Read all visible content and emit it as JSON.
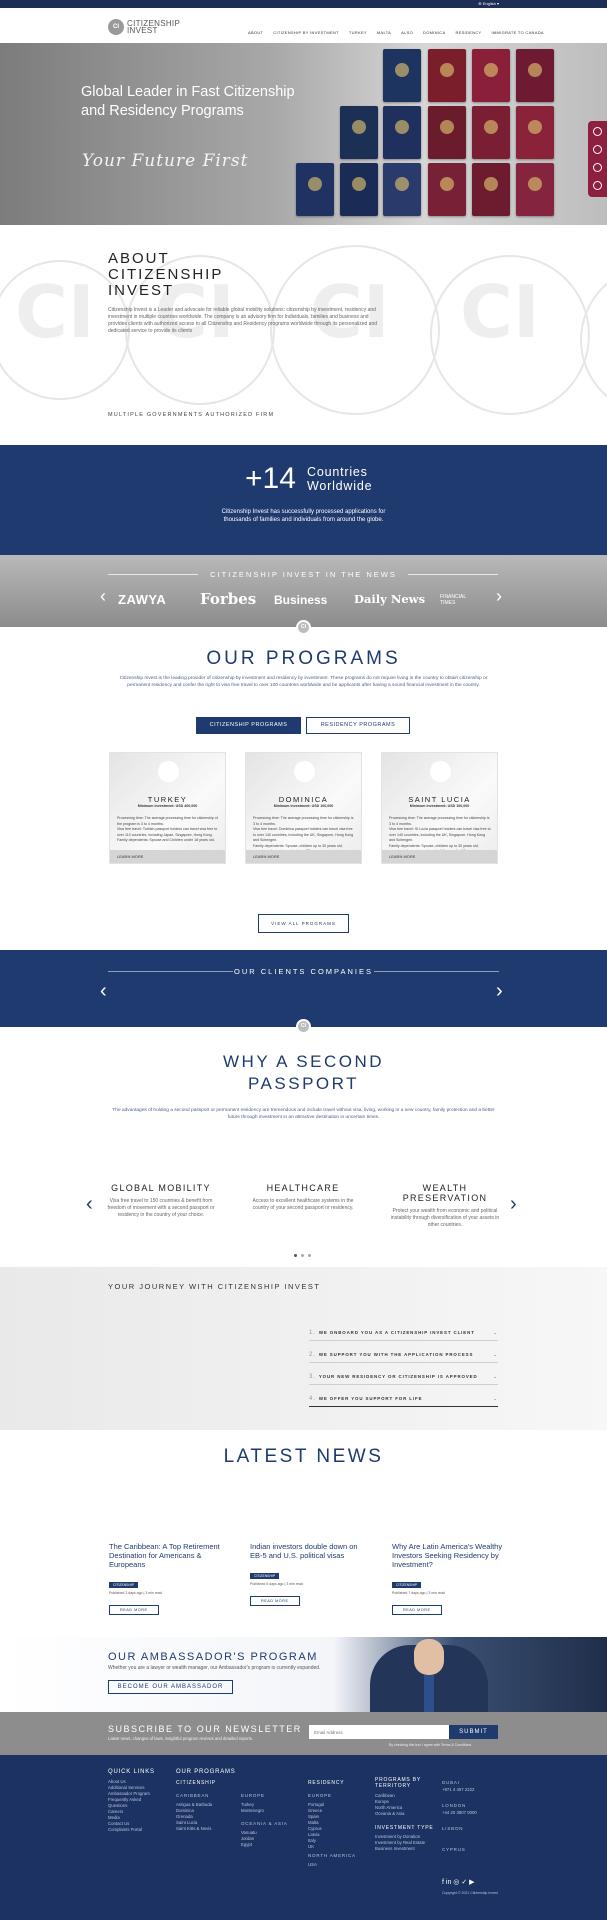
{
  "topbar": {
    "language": "English"
  },
  "header": {
    "logo_mark": "CI",
    "logo_line1": "CITIZENSHIP",
    "logo_line2": "INVEST",
    "nav": [
      "ABOUT",
      "CITIZENSHIP BY INVESTMENT",
      "TURKEY",
      "MALTA",
      "ALSO",
      "DOMINICA",
      "RESIDENCY",
      "IMMIGRATE TO CANADA"
    ]
  },
  "hero": {
    "title": "Global Leader in Fast Citizenship and Residency Programs",
    "signature": "Your Future First"
  },
  "about": {
    "title_line1": "ABOUT",
    "title_line2": "CITIZENSHIP",
    "title_line3": "INVEST",
    "text": "Citizenship Invest is a Leader and advocate for reliable global mobility solutions: citizenship by investment, residency and investment in multiple countries worldwide. The company is an advisory firm for Individuals, families and business and provides clients with authorized access to all Citizenship and Residency programs worldwide through its personalized and dedicated service to provide its clients",
    "ci_watermark": "CI",
    "subtitle": "MULTIPLE GOVERNMENTS AUTHORIZED FIRM"
  },
  "countries": {
    "count": "+14",
    "word1": "Countries",
    "word2": "Worldwide",
    "text": "Citizenship Invest has successfully processed applications for thousands of families and individuals from around the globe."
  },
  "in_the_news": {
    "heading": "CITIZENSHIP INVEST IN THE NEWS",
    "outlets": [
      "ZAWYA",
      "Forbes",
      "Business",
      "Daily News",
      "FINANCIAL TIMES"
    ],
    "badge": "CI",
    "prev_icon": "chevron-left-icon",
    "next_icon": "chevron-right-icon"
  },
  "programs": {
    "title": "OUR PROGRAMS",
    "text": "Citizenship Invest is the leading provider of citizenship by investment and residency by investment. These programs do not require living in the country to obtain citizenship or permanent residency and confer the right to visa free travel to over 100 countries worldwide and be applicants after having a sound financial investment in the country.",
    "tab_citizenship": "CITIZENSHIP PROGRAMS",
    "tab_residency": "RESIDENCY PROGRAMS",
    "cards": [
      {
        "name": "TURKEY",
        "min": "Minimum Investment: USD 400,000",
        "body1": "Processing time: The average processing time for citizenship of the program is 3 to 4 months.",
        "body2": "Visa free travel: Turkish passport holders can travel visa free to over 110 countries, including Japan, Singapore, Hong Kong.",
        "body3": "Family dependents: Spouse and Children under 18 years old.",
        "learn": "LEARN MORE"
      },
      {
        "name": "DOMINICA",
        "min": "Minimum Investment: USD 100,000",
        "body1": "Processing time: The average processing time for citizenship is 3 to 4 months.",
        "body2": "Visa free travel: Dominica passport holders can travel visa free to over 140 countries, including the UK, Singapore, Hong Kong and Schengen.",
        "body3": "Family dependents: Spouse, children up to 30 years old, parents and grandparents above 55 years.",
        "learn": "LEARN MORE"
      },
      {
        "name": "SAINT LUCIA",
        "min": "Minimum Investment: USD 100,000",
        "body1": "Processing time: The average processing time for citizenship is 3 to 4 months.",
        "body2": "Visa free travel: St Lucia passport holders can travel visa free to over 140 countries, including the UK, Singapore, Hong Kong and Schengen.",
        "body3": "Family dependents: Spouse, children up to 30 years old, parents and grandparents and siblings under 18.",
        "learn": "LEARN MORE"
      }
    ],
    "view_all": "VIEW ALL PROGRAMS"
  },
  "clients": {
    "heading": "OUR CLIENTS COMPANIES",
    "badge": "CI"
  },
  "why": {
    "title_line1": "WHY A SECOND",
    "title_line2": "PASSPORT",
    "text": "The advantages of holding a second passport or permanent residency are tremendous and include travel without visa, living, working in a new country, family protection and a better future through investment in an attractive destination in uncertain times.",
    "columns": [
      {
        "title": "GLOBAL MOBILITY",
        "desc": "Visa free travel to 150 countries & benefit from freedom of movement with a second passport or residency in the country of your choice."
      },
      {
        "title": "HEALTHCARE",
        "desc": "Access to excellent healthcare systems in the country of your second passport or residency."
      },
      {
        "title": "WEALTH PRESERVATION",
        "desc": "Protect your wealth from economic and political instability through diversification of your assets in other countries."
      }
    ]
  },
  "journey": {
    "title": "YOUR JOURNEY WITH CITIZENSHIP INVEST",
    "steps": [
      {
        "num": "1.",
        "label": "WE ONBOARD YOU AS A CITIZENSHIP INVEST CLIENT"
      },
      {
        "num": "2.",
        "label": "WE SUPPORT YOU WITH THE APPLICATION PROCESS"
      },
      {
        "num": "3.",
        "label": "YOUR NEW RESIDENCY OR CITIZENSHIP IS APPROVED"
      },
      {
        "num": "4.",
        "label": "WE OFFER YOU SUPPORT FOR LIFE"
      }
    ]
  },
  "latest_news": {
    "title": "LATEST NEWS",
    "items": [
      {
        "headline": "The Caribbean: A Top Retirement Destination for Americans & Europeans",
        "tag": "CITIZENSHIP",
        "date": "Published 2 days ago | 3 min read",
        "cta": "READ MORE"
      },
      {
        "headline": "Indian investors double down on EB-5 and U.S. political visas",
        "tag": "CITIZENSHIP",
        "date": "Published 5 days ago | 3 min read",
        "cta": "READ MORE"
      },
      {
        "headline": "Why Are Latin America's Wealthy Investors Seeking Residency by Investment?",
        "tag": "CITIZENSHIP",
        "date": "Published 7 days ago | 3 min read",
        "cta": "READ MORE"
      }
    ]
  },
  "ambassador": {
    "title": "OUR AMBASSADOR'S PROGRAM",
    "desc": "Whether you are a lawyer or wealth manager, our Ambassador's program is currently expanded.",
    "button": "BECOME OUR AMBASSADOR"
  },
  "newsletter": {
    "title": "SUBSCRIBE TO OUR NEWSLETTER",
    "desc": "Latest news, changes of laws, insightful program reviews and detailed reports.",
    "placeholder": "Email Address",
    "submit": "SUBMIT",
    "agree": "By checking this box I agree with Terms & Conditions"
  },
  "footer": {
    "quick_links_title": "QUICK LINKS",
    "quick_links": [
      "About Us",
      "Additional Services",
      "Ambassador Program",
      "Frequently Asked",
      "Questions",
      "Careers",
      "Media",
      "Contact Us",
      "Complaints Portal"
    ],
    "programs_title": "OUR PROGRAMS",
    "citizenship_title": "CITIZENSHIP",
    "caribbean_title": "CARIBBEAN",
    "caribbean": [
      "Antigua & Barbuda",
      "Dominica",
      "Grenada",
      "Saint Lucia",
      "Saint Kitts & Nevis"
    ],
    "europe_title": "EUROPE",
    "europe": [
      "Turkey",
      "Montenegro"
    ],
    "oceania_title": "OCEANIA & ASIA",
    "oceania": [
      "Vanuatu",
      "Jordan",
      "Egypt"
    ],
    "residency_title": "RESIDENCY",
    "residency_europe": "EUROPE",
    "residency": [
      "Portugal",
      "Greece",
      "Spain",
      "Malta",
      "Cyprus",
      "Latvia",
      "Italy",
      "UK"
    ],
    "north_america": "NORTH AMERICA",
    "north_america_items": [
      "USA"
    ],
    "territory_title": "PROGRAMS BY TERRITORY",
    "territory": [
      "Caribbean",
      "Europe",
      "North America",
      "Oceania & Asia"
    ],
    "investment_title": "INVESTMENT TYPE",
    "investment": [
      "Investment by Donation",
      "Investment by Real Estate",
      "Business Investment"
    ],
    "dubai_title": "DUBAI",
    "dubai_phone": "+971 4 457 2222",
    "london_title": "LONDON",
    "london_phone": "+44 20 3807 0000",
    "lisbon_title": "LISBON",
    "cyprus_title": "CYPRUS",
    "social_label": "f in ◎ ✓ ▶",
    "copyright": "Copyright © 2021 Citizenship Invest"
  }
}
